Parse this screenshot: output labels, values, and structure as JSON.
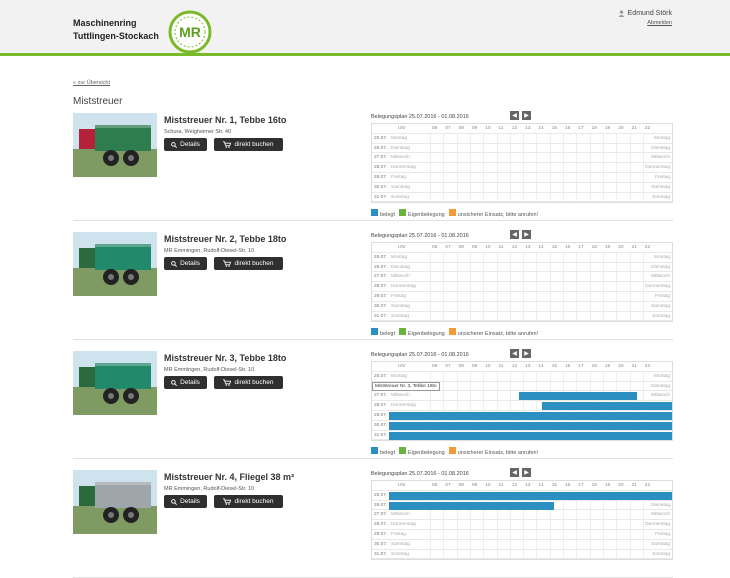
{
  "header": {
    "org_line1": "Maschinenring",
    "org_line2": "Tuttlingen-Stockach",
    "logo_text": "MR",
    "user_name": "Edmund Störk",
    "logout": "Abmelden"
  },
  "colors": {
    "accent": "#7ab929",
    "booked": "#2b8fc1",
    "own": "#67b33c",
    "uncertain": "#f29b36"
  },
  "page": {
    "back_link": "« zur Übersicht",
    "title": "Miststreuer"
  },
  "buttons": {
    "details": "Details",
    "book": "direkt buchen"
  },
  "calendar": {
    "period": "Belegungsplan 25.07.2016 - 01.08.2016",
    "uhr": "Uhr",
    "hours": [
      "06",
      "07",
      "08",
      "09",
      "10",
      "11",
      "12",
      "13",
      "14",
      "15",
      "16",
      "17",
      "18",
      "19",
      "20",
      "21",
      "22"
    ],
    "dates": [
      "25.07.",
      "26.07.",
      "27.07.",
      "28.07.",
      "29.07.",
      "30.07.",
      "31.07."
    ],
    "days": [
      "Montag",
      "Dienstag",
      "Mittwoch",
      "Donnerstag",
      "Freitag",
      "Samstag",
      "Sonntag"
    ],
    "legend": {
      "booked": "belegt",
      "own": "Eigenbelegung",
      "uncertain": "unsicherer Einsatz, bitte anrufen!"
    }
  },
  "machines": [
    {
      "name": "Miststreuer Nr. 1, Tebbe 16to",
      "address": "Schura, Weigheimer Str. 40",
      "bookings": []
    },
    {
      "name": "Miststreuer Nr. 2, Tebbe 18to",
      "address": "MR Emmingen, Rudolf-Diesel-Str. 10",
      "bookings": []
    },
    {
      "name": "Miststreuer Nr. 3, Tebbe 18to",
      "address": "MR Emmingen, Rudolf-Diesel-Str. 10",
      "tooltip": "Miststreuer Nr. 3, Tebbe 18to",
      "bookings": [
        {
          "day": 2,
          "from": 11,
          "to": 21
        },
        {
          "day": 3,
          "from": 13,
          "to": 24
        },
        {
          "day": 4,
          "from": 0,
          "to": 24
        },
        {
          "day": 5,
          "from": 0,
          "to": 24
        },
        {
          "day": 6,
          "from": 0,
          "to": 24
        }
      ]
    },
    {
      "name": "Miststreuer Nr. 4, Fliegel 38 m³",
      "address": "MR Emmingen, Rudolf-Diesel-Str. 10",
      "bookings": [
        {
          "day": 0,
          "from": 0,
          "to": 24
        },
        {
          "day": 1,
          "from": 0,
          "to": 14
        }
      ]
    }
  ]
}
